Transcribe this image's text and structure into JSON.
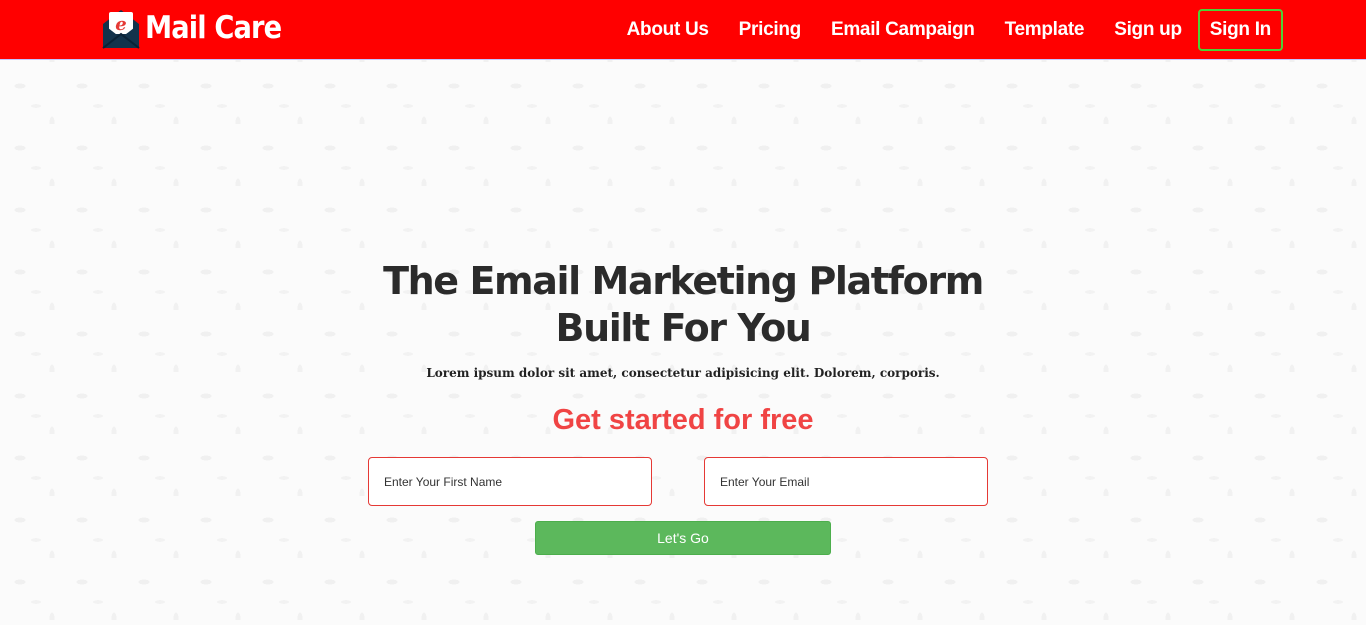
{
  "brand": {
    "name": "Mail Care",
    "logo_icon": "envelope-e-icon",
    "colors": {
      "navbar": "#ff0000",
      "logo_fill": "#13334c",
      "logo_letter": "#e53935"
    }
  },
  "nav": {
    "links": [
      "About Us",
      "Pricing",
      "Email Campaign",
      "Template",
      "Sign up"
    ],
    "signin_label": "Sign In",
    "signin_border": "#4cd137"
  },
  "hero": {
    "title": "The Email Marketing Platform Built For You",
    "subtitle": "Lorem ipsum dolor sit amet, consectetur adipisicing elit. Dolorem, corporis.",
    "cta_heading": "Get started for free",
    "cta_color": "#f04444"
  },
  "form": {
    "first_name_placeholder": "Enter Your First Name",
    "email_placeholder": "Enter Your Email",
    "submit_label": "Let's Go",
    "submit_color": "#5cb85c"
  }
}
